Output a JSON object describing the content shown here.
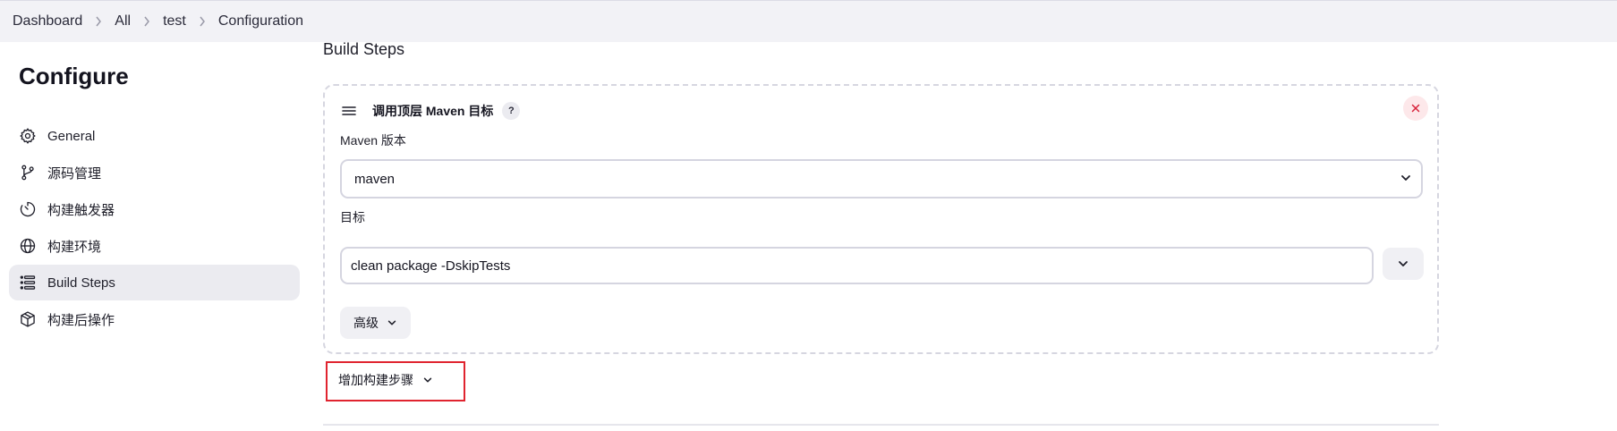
{
  "breadcrumb": {
    "items": [
      "Dashboard",
      "All",
      "test",
      "Configuration"
    ]
  },
  "sidebar": {
    "title": "Configure",
    "items": [
      {
        "label": "General",
        "icon": "gear-icon"
      },
      {
        "label": "源码管理",
        "icon": "git-branch-icon"
      },
      {
        "label": "构建触发器",
        "icon": "timer-icon"
      },
      {
        "label": "构建环境",
        "icon": "globe-icon"
      },
      {
        "label": "Build Steps",
        "icon": "list-icon",
        "active": true
      },
      {
        "label": "构建后操作",
        "icon": "package-icon"
      }
    ]
  },
  "main": {
    "section_title": "Build Steps",
    "step": {
      "title": "调用顶层 Maven 目标",
      "help": "?",
      "maven_version_label": "Maven 版本",
      "maven_version_value": "maven",
      "goals_label": "目标",
      "goals_value": "clean package -DskipTests",
      "advanced_label": "高级"
    },
    "add_step_label": "增加构建步骤"
  },
  "colors": {
    "breadcrumb_bg": "#f2f2f6",
    "active_nav_bg": "#ebebf0",
    "close_red": "#d8243b",
    "highlight_red": "#e0242f"
  }
}
